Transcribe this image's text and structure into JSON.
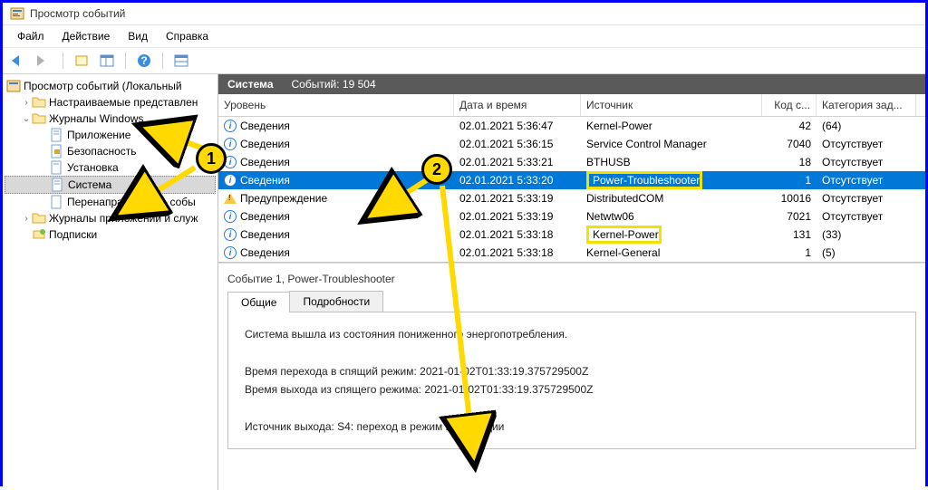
{
  "title": "Просмотр событий",
  "menu": [
    "Файл",
    "Действие",
    "Вид",
    "Справка"
  ],
  "tree": {
    "root": "Просмотр событий (Локальный",
    "n1": "Настраиваемые представлен",
    "n2": "Журналы Windows",
    "n2_children": [
      "Приложение",
      "Безопасность",
      "Установка",
      "Система",
      "Перенаправленные собы"
    ],
    "n3": "Журналы приложений и служ",
    "n4": "Подписки"
  },
  "pane": {
    "title": "Система",
    "count_label": "Событий: 19 504"
  },
  "columns": {
    "level": "Уровень",
    "date": "Дата и время",
    "src": "Источник",
    "code": "Код с...",
    "cat": "Категория зад..."
  },
  "rows": [
    {
      "level": "Сведения",
      "date": "02.01.2021 5:36:47",
      "src": "Kernel-Power",
      "code": "42",
      "cat": "(64)",
      "icon": "i"
    },
    {
      "level": "Сведения",
      "date": "02.01.2021 5:36:15",
      "src": "Service Control Manager",
      "code": "7040",
      "cat": "Отсутствует",
      "icon": "i"
    },
    {
      "level": "Сведения",
      "date": "02.01.2021 5:33:21",
      "src": "BTHUSB",
      "code": "18",
      "cat": "Отсутствует",
      "icon": "i"
    },
    {
      "level": "Сведения",
      "date": "02.01.2021 5:33:20",
      "src": "Power-Troubleshooter",
      "code": "1",
      "cat": "Отсутствует",
      "icon": "i",
      "selected": true,
      "hl_src": true
    },
    {
      "level": "Предупреждение",
      "date": "02.01.2021 5:33:19",
      "src": "DistributedCOM",
      "code": "10016",
      "cat": "Отсутствует",
      "icon": "w"
    },
    {
      "level": "Сведения",
      "date": "02.01.2021 5:33:19",
      "src": "Netwtw06",
      "code": "7021",
      "cat": "Отсутствует",
      "icon": "i"
    },
    {
      "level": "Сведения",
      "date": "02.01.2021 5:33:18",
      "src": "Kernel-Power",
      "code": "131",
      "cat": "(33)",
      "icon": "i",
      "hl_src": true
    },
    {
      "level": "Сведения",
      "date": "02.01.2021 5:33:18",
      "src": "Kernel-General",
      "code": "1",
      "cat": "(5)",
      "icon": "i"
    }
  ],
  "detail": {
    "title": "Событие 1, Power-Troubleshooter",
    "tabs": [
      "Общие",
      "Подробности"
    ],
    "body": {
      "l1": "Система вышла из состояния пониженного энергопотребления.",
      "l2": "Время перехода в спящий режим: 2021-01-02T01:33:19.375729500Z",
      "l3": "Время выхода из спящего режима: 2021-01-02T01:33:19.375729500Z",
      "l4": "Источник выхода: S4: переход в режим гибернации"
    }
  },
  "callouts": {
    "c1": "1",
    "c2": "2"
  }
}
